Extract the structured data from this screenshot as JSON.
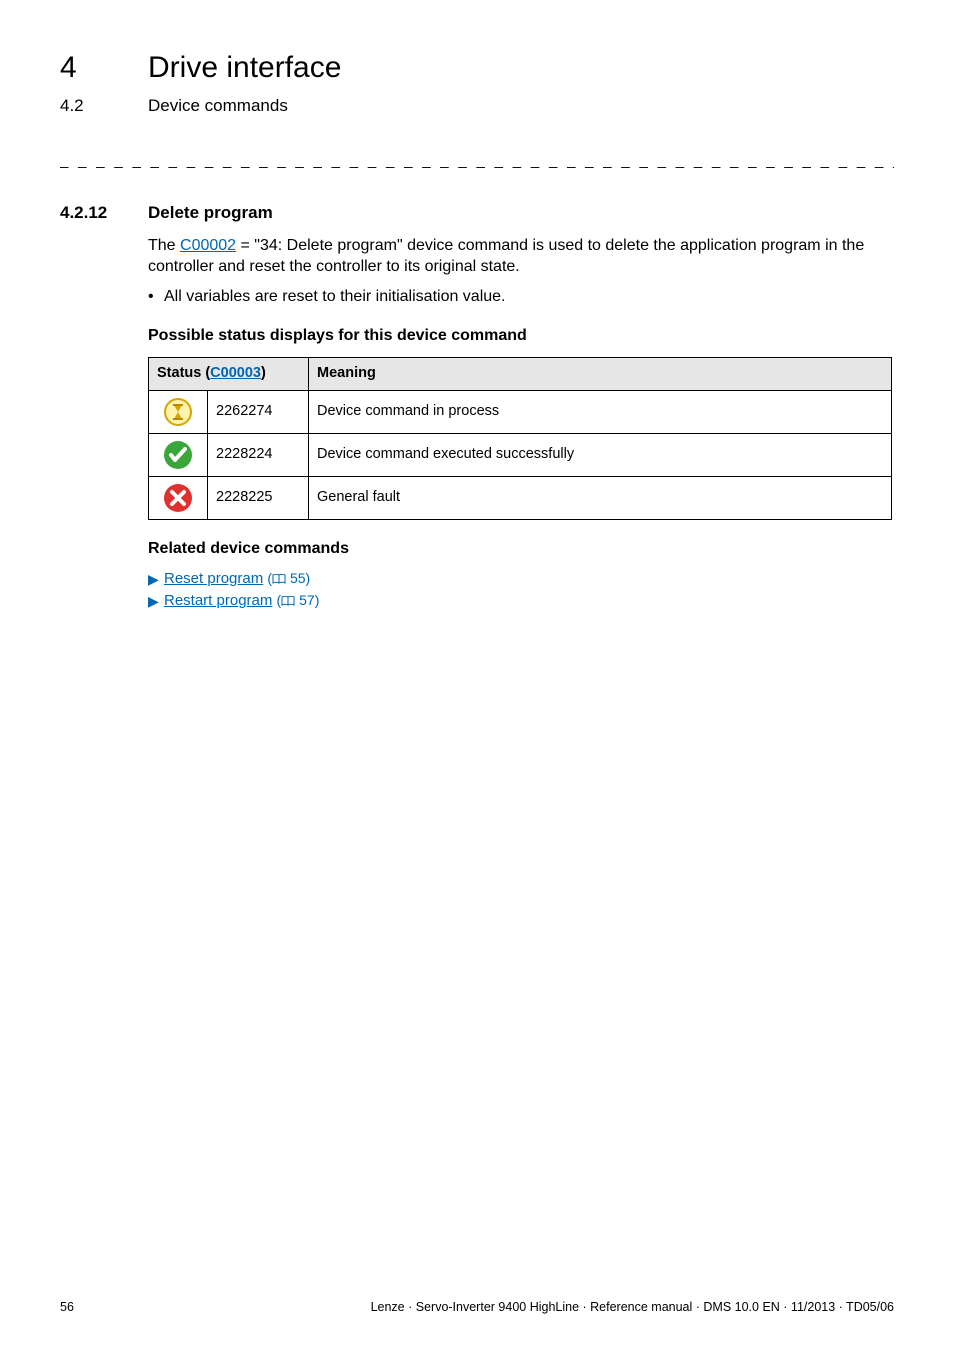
{
  "header": {
    "chapter_num": "4",
    "chapter_title": "Drive interface",
    "section_num": "4.2",
    "section_title": "Device commands"
  },
  "rule": "_ _ _ _ _ _ _ _ _ _ _ _ _ _ _ _ _ _ _ _ _ _ _ _ _ _ _ _ _ _ _ _ _ _ _ _ _ _ _ _ _ _ _ _ _ _ _ _ _ _ _ _ _ _ _ _ _ _ _ _ _ _ _ _",
  "subsection": {
    "num": "4.2.12",
    "title": "Delete program"
  },
  "intro": {
    "before_link": "The ",
    "link": "C00002",
    "after_link": " = \"34: Delete program\" device command is used to delete the application program in the controller and reset the controller to its original state."
  },
  "bullets": [
    "All variables are reset to their initialisation value."
  ],
  "status_heading": "Possible status displays for this device command",
  "table": {
    "headers": {
      "status_label": "Status (",
      "status_link": "C00003",
      "status_close": ")",
      "meaning": "Meaning"
    },
    "rows": [
      {
        "icon": "hourglass",
        "code": "2262274",
        "meaning": "Device command in process"
      },
      {
        "icon": "check",
        "code": "2228224",
        "meaning": "Device command executed successfully"
      },
      {
        "icon": "cross",
        "code": "2228225",
        "meaning": "General fault"
      }
    ]
  },
  "related": {
    "heading": "Related device commands",
    "items": [
      {
        "label": "Reset program",
        "page": "55"
      },
      {
        "label": "Restart program",
        "page": "57"
      }
    ]
  },
  "footer": {
    "page": "56",
    "text": "Lenze · Servo-Inverter 9400 HighLine · Reference manual · DMS 10.0 EN · 11/2013 · TD05/06"
  }
}
